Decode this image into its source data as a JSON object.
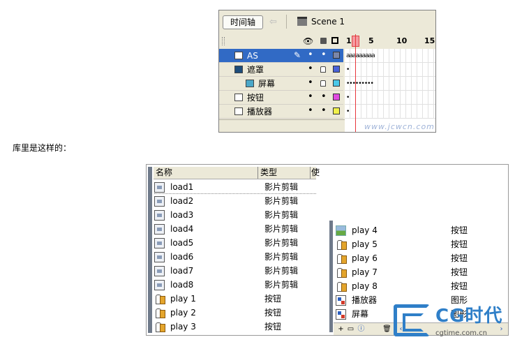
{
  "timeline": {
    "tab_label": "时间轴",
    "scene_label": "Scene 1",
    "frame_numbers": [
      "1",
      "5",
      "10",
      "15"
    ],
    "layers": [
      {
        "name": "AS",
        "color": "#7a86a8",
        "selected": true
      },
      {
        "name": "遮罩",
        "color": "#4a62d8",
        "selected": false
      },
      {
        "name": "屏幕",
        "color": "#4ac8e8",
        "selected": false
      },
      {
        "name": "按钮",
        "color": "#e04ae0",
        "selected": false
      },
      {
        "name": "播放器",
        "color": "#f0f04a",
        "selected": false
      }
    ],
    "frame_rows": [
      "aaaaaaaaa",
      "•",
      "•••••••••",
      "•",
      "•"
    ],
    "watermark": "www.jcwcn.com"
  },
  "caption": "库里是这样的：",
  "library": {
    "headers": {
      "name": "名称",
      "type": "类型",
      "extra": "使"
    },
    "left_items": [
      {
        "name": "load1",
        "type": "影片剪辑",
        "icon": "movieclip"
      },
      {
        "name": "load2",
        "type": "影片剪辑",
        "icon": "movieclip"
      },
      {
        "name": "load3",
        "type": "影片剪辑",
        "icon": "movieclip"
      },
      {
        "name": "load4",
        "type": "影片剪辑",
        "icon": "movieclip"
      },
      {
        "name": "load5",
        "type": "影片剪辑",
        "icon": "movieclip"
      },
      {
        "name": "load6",
        "type": "影片剪辑",
        "icon": "movieclip"
      },
      {
        "name": "load7",
        "type": "影片剪辑",
        "icon": "movieclip"
      },
      {
        "name": "load8",
        "type": "影片剪辑",
        "icon": "movieclip"
      },
      {
        "name": "play 1",
        "type": "按钮",
        "icon": "button"
      },
      {
        "name": "play 2",
        "type": "按钮",
        "icon": "button"
      },
      {
        "name": "play 3",
        "type": "按钮",
        "icon": "button"
      }
    ],
    "right_items": [
      {
        "name": "play 4",
        "type": "按钮",
        "icon": "bitmap"
      },
      {
        "name": "play 5",
        "type": "按钮",
        "icon": "button"
      },
      {
        "name": "play 6",
        "type": "按钮",
        "icon": "button"
      },
      {
        "name": "play 7",
        "type": "按钮",
        "icon": "button"
      },
      {
        "name": "play 8",
        "type": "按钮",
        "icon": "button"
      },
      {
        "name": "播放器",
        "type": "图形",
        "icon": "graphic"
      },
      {
        "name": "屏幕",
        "type": "图形",
        "icon": "graphic"
      }
    ]
  },
  "logo": {
    "text": "CG时代",
    "url": "cgtime.com.cn"
  }
}
